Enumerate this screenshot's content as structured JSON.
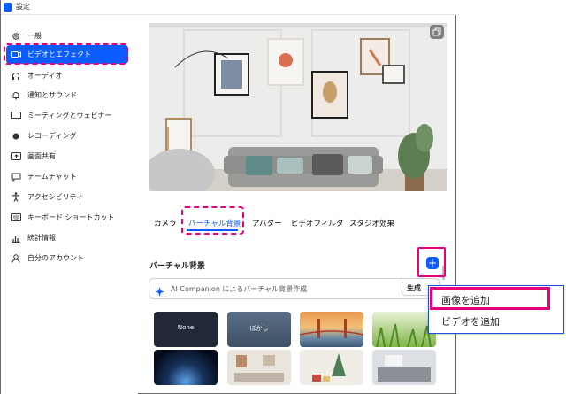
{
  "window": {
    "title": "設定"
  },
  "sidebar": {
    "items": [
      {
        "label": "一般",
        "icon": "gear-icon"
      },
      {
        "label": "ビデオとエフェクト",
        "icon": "video-icon",
        "active": true
      },
      {
        "label": "オーディオ",
        "icon": "headphones-icon"
      },
      {
        "label": "通知とサウンド",
        "icon": "bell-icon"
      },
      {
        "label": "ミーティングとウェビナー",
        "icon": "meeting-icon"
      },
      {
        "label": "レコーディング",
        "icon": "record-icon"
      },
      {
        "label": "画面共有",
        "icon": "share-screen-icon"
      },
      {
        "label": "チームチャット",
        "icon": "chat-icon"
      },
      {
        "label": "アクセシビリティ",
        "icon": "accessibility-icon"
      },
      {
        "label": "キーボード ショートカット",
        "icon": "keyboard-icon"
      },
      {
        "label": "統計情報",
        "icon": "stats-icon"
      },
      {
        "label": "自分のアカウント",
        "icon": "account-icon"
      }
    ]
  },
  "tabs": [
    {
      "label": "カメラ"
    },
    {
      "label": "バーチャル背景",
      "active": true
    },
    {
      "label": "アバター"
    },
    {
      "label": "ビデオフィルタ"
    },
    {
      "label": "スタジオ効果"
    }
  ],
  "virtual_bg": {
    "section_title": "バーチャル背景",
    "add_label": "+",
    "ai_text": "AI Companion によるバーチャル背景作成",
    "ai_button": "生成",
    "thumbs": [
      {
        "label": "None"
      },
      {
        "label": "ぼかし"
      },
      {
        "label": ""
      },
      {
        "label": ""
      },
      {
        "label": ""
      },
      {
        "label": ""
      },
      {
        "label": ""
      },
      {
        "label": ""
      }
    ]
  },
  "add_menu": {
    "items": [
      {
        "label": "画像を追加"
      },
      {
        "label": "ビデオを追加"
      }
    ]
  },
  "colors": {
    "accent": "#0b5cff",
    "highlight": "#e6007e"
  }
}
